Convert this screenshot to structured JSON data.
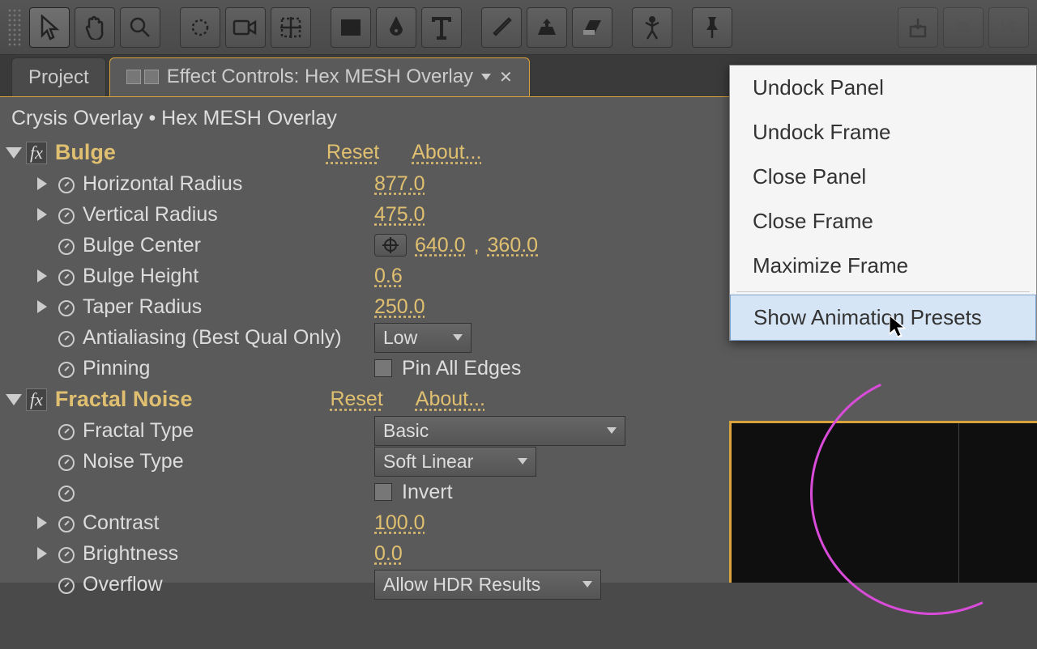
{
  "tabs": {
    "project": "Project",
    "effect_controls": "Effect Controls: Hex MESH Overlay"
  },
  "breadcrumb": "Crysis Overlay • Hex MESH Overlay",
  "effects": [
    {
      "name": "Bulge",
      "reset": "Reset",
      "about": "About...",
      "props": [
        {
          "label": "Horizontal Radius",
          "value": "877.0",
          "twirl": true
        },
        {
          "label": "Vertical Radius",
          "value": "475.0",
          "twirl": true
        },
        {
          "label": "Bulge Center",
          "valuex": "640.0",
          "valuey": "360.0",
          "target": true
        },
        {
          "label": "Bulge Height",
          "value": "0.6",
          "twirl": true
        },
        {
          "label": "Taper Radius",
          "value": "250.0",
          "twirl": true
        },
        {
          "label": "Antialiasing (Best Qual Only)",
          "select": "Low"
        },
        {
          "label": "Pinning",
          "checkbox": "Pin All Edges"
        }
      ]
    },
    {
      "name": "Fractal Noise",
      "reset": "Reset",
      "about": "About...",
      "props": [
        {
          "label": "Fractal Type",
          "select": "Basic",
          "wide": true
        },
        {
          "label": "Noise Type",
          "select": "Soft Linear"
        },
        {
          "label": "",
          "checkbox": "Invert"
        },
        {
          "label": "Contrast",
          "value": "100.0",
          "twirl": true
        },
        {
          "label": "Brightness",
          "value": "0.0",
          "twirl": true
        },
        {
          "label": "Overflow",
          "select": "Allow HDR Results",
          "wide": true
        }
      ]
    }
  ],
  "context_menu": {
    "undock_panel": "Undock Panel",
    "undock_frame": "Undock Frame",
    "close_panel": "Close Panel",
    "close_frame": "Close Frame",
    "maximize_frame": "Maximize Frame",
    "show_presets": "Show Animation Presets"
  }
}
